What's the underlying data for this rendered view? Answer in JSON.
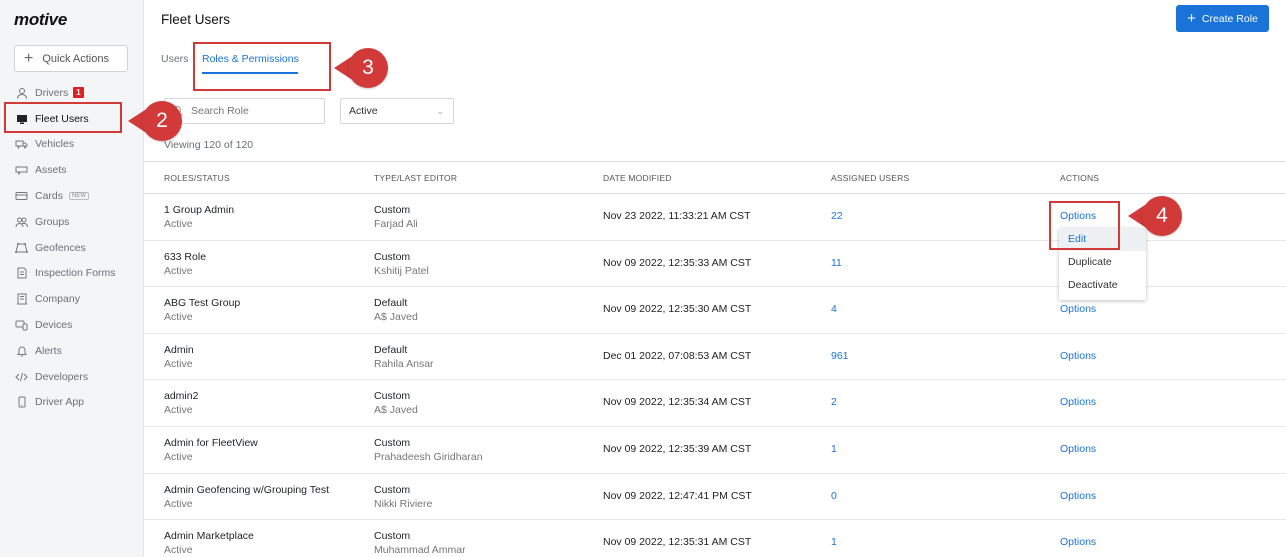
{
  "brand": "motive",
  "sidebar": {
    "quick_actions": "Quick Actions",
    "items": [
      {
        "label": "Drivers",
        "icon": "user-icon",
        "badge": "1"
      },
      {
        "label": "Fleet Users",
        "icon": "monitor-icon",
        "active": true
      },
      {
        "label": "Vehicles",
        "icon": "truck-icon"
      },
      {
        "label": "Assets",
        "icon": "trailer-icon"
      },
      {
        "label": "Cards",
        "icon": "card-icon",
        "tag": "NEW"
      },
      {
        "label": "Groups",
        "icon": "groups-icon"
      },
      {
        "label": "Geofences",
        "icon": "geofence-icon"
      },
      {
        "label": "Inspection Forms",
        "icon": "form-icon"
      },
      {
        "label": "Company",
        "icon": "building-icon"
      },
      {
        "label": "Devices",
        "icon": "devices-icon"
      },
      {
        "label": "Alerts",
        "icon": "bell-icon"
      },
      {
        "label": "Developers",
        "icon": "code-icon"
      },
      {
        "label": "Driver App",
        "icon": "phone-icon"
      }
    ]
  },
  "header": {
    "title": "Fleet Users",
    "create_label": "Create Role"
  },
  "tabs": [
    {
      "label": "Users"
    },
    {
      "label": "Roles & Permissions",
      "active": true
    }
  ],
  "filters": {
    "search_placeholder": "Search Role",
    "status_value": "Active"
  },
  "viewing": "Viewing 120 of 120",
  "table": {
    "headers": [
      "ROLES/STATUS",
      "TYPE/LAST EDITOR",
      "DATE MODIFIED",
      "ASSIGNED USERS",
      "ACTIONS"
    ],
    "rows": [
      {
        "role": "1 Group Admin",
        "status": "Active",
        "type": "Custom",
        "editor": "Farjad Ali",
        "date": "Nov 23 2022, 11:33:21 AM CST",
        "users": "22",
        "action": "Options"
      },
      {
        "role": "633 Role",
        "status": "Active",
        "type": "Custom",
        "editor": "Kshitij Patel",
        "date": "Nov 09 2022, 12:35:33 AM CST",
        "users": "11",
        "action": "Options"
      },
      {
        "role": "ABG Test Group",
        "status": "Active",
        "type": "Default",
        "editor": "A$ Javed",
        "date": "Nov 09 2022, 12:35:30 AM CST",
        "users": "4",
        "action": "Options"
      },
      {
        "role": "Admin",
        "status": "Active",
        "type": "Default",
        "editor": "Rahila Ansar",
        "date": "Dec 01 2022, 07:08:53 AM CST",
        "users": "961",
        "action": "Options"
      },
      {
        "role": "admin2",
        "status": "Active",
        "type": "Custom",
        "editor": "A$ Javed",
        "date": "Nov 09 2022, 12:35:34 AM CST",
        "users": "2",
        "action": "Options"
      },
      {
        "role": "Admin for FleetView",
        "status": "Active",
        "type": "Custom",
        "editor": "Prahadeesh Giridharan",
        "date": "Nov 09 2022, 12:35:39 AM CST",
        "users": "1",
        "action": "Options"
      },
      {
        "role": "Admin Geofencing w/Grouping Test",
        "status": "Active",
        "type": "Custom",
        "editor": "Nikki Riviere",
        "date": "Nov 09 2022, 12:47:41 PM CST",
        "users": "0",
        "action": "Options"
      },
      {
        "role": "Admin Marketplace",
        "status": "Active",
        "type": "Custom",
        "editor": "Muhammad Ammar",
        "date": "Nov 09 2022, 12:35:31 AM CST",
        "users": "1",
        "action": "Options"
      }
    ]
  },
  "menu": {
    "items": [
      "Edit",
      "Duplicate",
      "Deactivate"
    ]
  },
  "annotations": [
    "2",
    "3",
    "4"
  ],
  "colors": {
    "accent": "#1a73d9",
    "annotation": "#d23a3a",
    "badge": "#e02020"
  }
}
